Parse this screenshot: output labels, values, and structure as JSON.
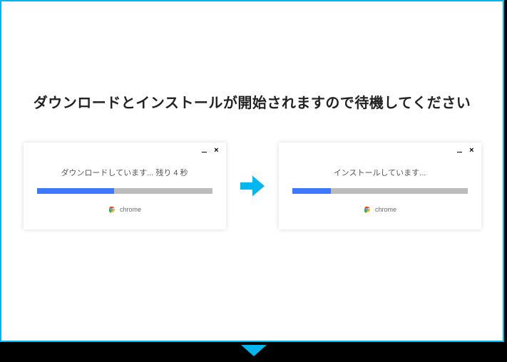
{
  "headline": "ダウンロードとインストールが開始されますので待機してください",
  "download_panel": {
    "status": "ダウンロードしています... 残り 4 秒",
    "progress_pct": 44,
    "brand_label": "chrome"
  },
  "install_panel": {
    "status": "インストールしています...",
    "progress_pct": 22,
    "brand_label": "chrome"
  }
}
